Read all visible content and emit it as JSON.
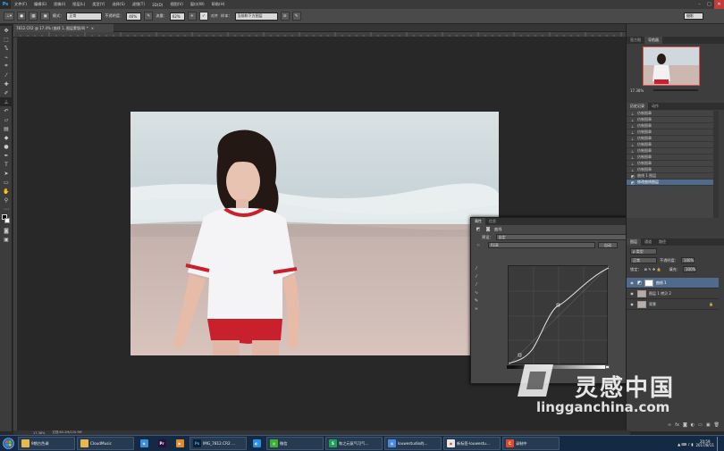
{
  "app": {
    "logo": "Ps",
    "title": "Photoshop"
  },
  "menu": [
    "文件(F)",
    "编辑(E)",
    "图像(I)",
    "图层(L)",
    "类型(Y)",
    "选择(S)",
    "滤镜(T)",
    "3D(D)",
    "视图(V)",
    "窗口(W)",
    "帮助(H)"
  ],
  "window_controls": {
    "minimize": "–",
    "maximize": "□",
    "close": "✕"
  },
  "options": {
    "mode_label": "模式：",
    "mode_value": "正常",
    "opacity_label": "不透明度：",
    "opacity_value": "40%",
    "flow_label": "流量：",
    "flow_value": "62%",
    "align_label": "对齐",
    "sample_label": "样本：",
    "sample_value": "当前和下方图层",
    "workspace": "摄影"
  },
  "document": {
    "tab": "7812.CR2 @ 17.4% (曲线 1, 图层蒙版/8) *",
    "tab_close": "×"
  },
  "status": {
    "zoom": "17.38%",
    "doc_info": "文档:60.2M/120.9M"
  },
  "navigator": {
    "tabs": [
      "直方图",
      "导航器"
    ],
    "zoom": "17.38%"
  },
  "history": {
    "tabs": [
      "历史记录",
      "动作"
    ],
    "items": [
      "仿制图章",
      "仿制图章",
      "仿制图章",
      "仿制图章",
      "仿制图章",
      "仿制图章",
      "仿制图章",
      "仿制图章",
      "仿制图章",
      "仿制图章",
      "曲线 1 图层",
      "修改曲线图层"
    ]
  },
  "layers": {
    "tabs": [
      "图层",
      "通道",
      "路径"
    ],
    "kind": "ρ 类型",
    "blend": "正常",
    "opacity_label": "不透明度：",
    "opacity_value": "100%",
    "lock_label": "锁定：",
    "fill_label": "填充：",
    "fill_value": "100%",
    "items": [
      {
        "name": "曲线 1",
        "selected": true
      },
      {
        "name": "图层 1 拷贝 2",
        "selected": false
      },
      {
        "name": "背景",
        "selected": false
      }
    ]
  },
  "properties": {
    "tabs": [
      "属性",
      "信息"
    ],
    "title": "曲线",
    "preset_label": "预设：",
    "preset_value": "自定",
    "channel_value": "RGB",
    "auto_label": "自动"
  },
  "taskbar": {
    "items": [
      {
        "label": "9期古色调",
        "icon": "folder"
      },
      {
        "label": "CloudMusic",
        "icon": "folder"
      },
      {
        "label": "",
        "icon": "network"
      },
      {
        "label": "",
        "icon": "premiere"
      },
      {
        "label": "",
        "icon": "media"
      },
      {
        "label": "IMG_7812.CR2 ...",
        "icon": "photoshop"
      },
      {
        "label": "",
        "icon": "qq"
      },
      {
        "label": "微信",
        "icon": "wechat"
      },
      {
        "label": "和之元氛气可气...",
        "icon": "sheet"
      },
      {
        "label": "louwestudio的...",
        "icon": "browser"
      },
      {
        "label": "新标签-louwestu...",
        "icon": "chrome"
      },
      {
        "label": "录制中",
        "icon": "recorder"
      }
    ],
    "clock": "20:59",
    "date": "2017/8/11"
  },
  "watermark": {
    "text": "灵感中国",
    "url": "lingganchina.com"
  }
}
